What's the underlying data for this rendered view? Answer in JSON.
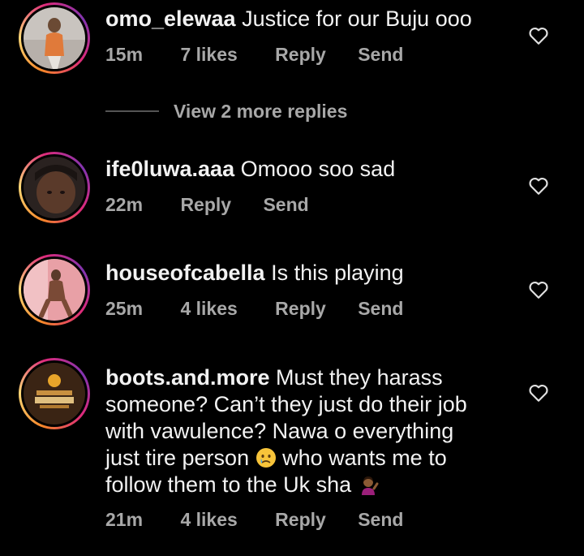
{
  "comments": [
    {
      "username": "omo_elewaa",
      "text": "Justice for our Buju ooo",
      "time": "15m",
      "likes": "7 likes",
      "reply_label": "Reply",
      "send_label": "Send"
    },
    {
      "username": "ife0luwa.aaa",
      "text": "Omooo soo sad",
      "time": "22m",
      "reply_label": "Reply",
      "send_label": "Send"
    },
    {
      "username": "houseofcabella",
      "text": "Is this playing",
      "time": "25m",
      "likes": "4 likes",
      "reply_label": "Reply",
      "send_label": "Send"
    },
    {
      "username": "boots.and.more",
      "text_part1": "Must they harass someone? Can’t they just do their job with vawulence? Nawa o  everything just tire person",
      "text_part2": "who wants me to follow them to the Uk sha",
      "time": "21m",
      "likes": "4 likes",
      "reply_label": "Reply",
      "send_label": "Send"
    }
  ],
  "view_more_replies": "View 2 more replies",
  "colors": {
    "background": "#000000",
    "text": "#f2f2f2",
    "muted": "#a8a8a8",
    "ring_gradient": [
      "#f58529",
      "#feda77",
      "#dd2a7b",
      "#8134af"
    ]
  },
  "icons": {
    "like": "heart-outline-icon",
    "emoji_sad": "crying-face-emoji",
    "emoji_shrug": "woman-tipping-hand-emoji"
  }
}
